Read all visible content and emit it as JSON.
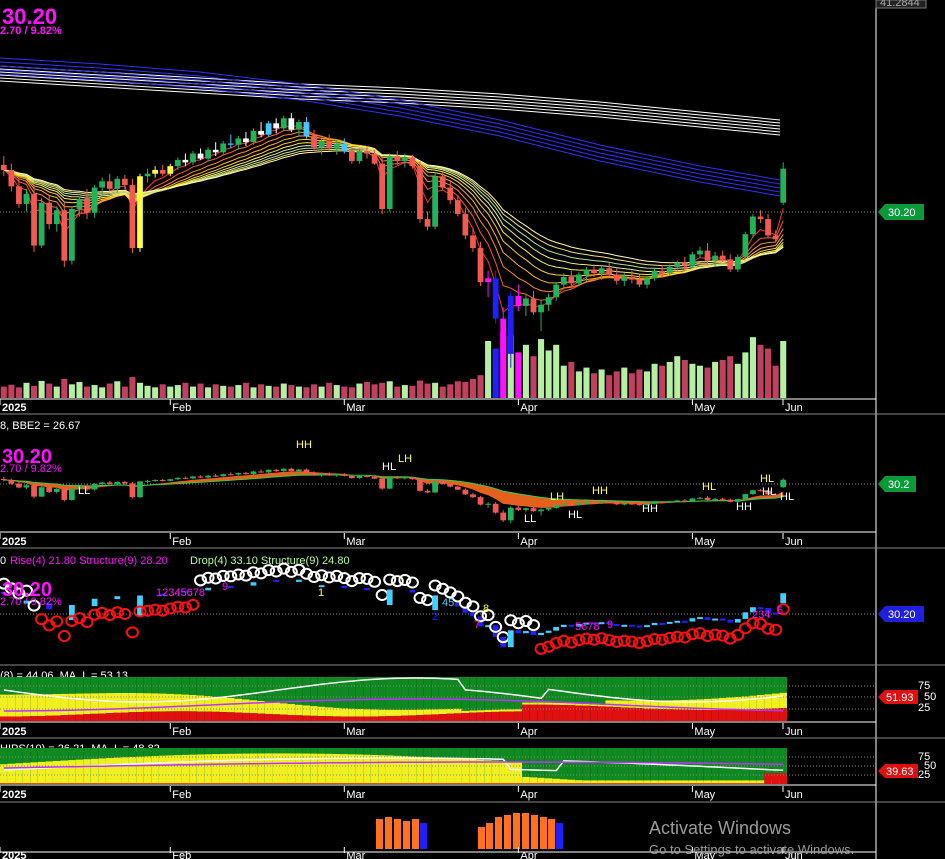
{
  "window": {
    "top_right_value": "41.2844",
    "watermark_title": "Activate Windows",
    "watermark_sub": "Go to Settings to activate Windows."
  },
  "colors": {
    "bg": "#000000",
    "bull": "#22b35a",
    "bear": "#f05a50",
    "vol_bull": "#b4f0a0",
    "vol_bear": "#c0405e",
    "sma_white": "#ffffff",
    "sma_blue": "#3030ff",
    "green_tag": "#0a9a3a",
    "blue_tag": "#1f1fe0",
    "red_tag": "#e01010",
    "magenta": "#ff10ff"
  },
  "price_panel": {
    "price_big": "30.20",
    "change_text": "2.70 / 9.82%",
    "last_price_tag": "30.20"
  },
  "panel2": {
    "header": "8, BBE2 = 26.67",
    "price_big": "30.20",
    "price_small": "2.70 / 9.82%",
    "last_tag": "30.2",
    "labels": [
      "HH",
      "LL",
      "HL",
      "LH",
      "LL",
      "LH",
      "HL",
      "HH",
      "HL",
      "HH",
      "HL",
      "HH",
      "HL",
      "HL"
    ]
  },
  "panel3": {
    "header_prefix": "0",
    "header_rise": "Rise(4) 21.80 Structure(9) 28.20",
    "header_drop": "Drop(4) 33.10 Structure(9) 24.80",
    "price_big": "30.20",
    "price_small": "2.70 / 9.82%",
    "last_tag": "30.20",
    "count_up": "12345678",
    "count_up_nine": "9",
    "count_2": "2",
    "count_45": "45",
    "count_7": "7",
    "count_8": "8",
    "count_5678": "5678",
    "count_nine2": "9",
    "count_234": "234",
    "count_5": "5",
    "count_1": "1"
  },
  "panel4": {
    "header": "(8) = 44.06, MA_L = 53.13",
    "levels": [
      "75",
      "50",
      "25"
    ],
    "last_tag": "51.93"
  },
  "panel5": {
    "header": "HIPS(10) = 26.21, MA_L = 48.82",
    "levels": [
      "75",
      "50",
      "25"
    ],
    "last_tag": "39.63"
  },
  "x_axis": {
    "labels": [
      "2025",
      "Feb",
      "Mar",
      "Apr",
      "May",
      "Jun"
    ]
  },
  "chart_data": [
    {
      "type": "candlestick",
      "categories_start": "2025",
      "x_ticks": [
        "2025",
        "Feb",
        "Mar",
        "Apr",
        "May",
        "Jun"
      ],
      "last_price": 30.2,
      "change": 2.7,
      "change_pct": 9.82,
      "candles": [
        [
          30.5,
          31.2,
          29.6,
          30.1
        ],
        [
          30.1,
          30.6,
          28.4,
          28.8
        ],
        [
          28.8,
          29.4,
          27.1,
          27.4
        ],
        [
          27.4,
          28.6,
          26.8,
          28.2
        ],
        [
          28.2,
          28.9,
          23.6,
          24.1
        ],
        [
          24.1,
          27.9,
          23.9,
          27.5
        ],
        [
          27.5,
          28.1,
          25.4,
          25.8
        ],
        [
          25.8,
          27.2,
          25.2,
          26.9
        ],
        [
          26.9,
          27.5,
          22.4,
          22.9
        ],
        [
          22.9,
          27.2,
          22.6,
          27.0
        ],
        [
          27.0,
          28.0,
          26.4,
          27.8
        ],
        [
          27.8,
          28.6,
          26.2,
          26.7
        ],
        [
          26.7,
          28.9,
          26.3,
          28.7
        ],
        [
          28.7,
          29.5,
          28.1,
          29.2
        ],
        [
          29.2,
          29.8,
          28.4,
          28.6
        ],
        [
          28.6,
          29.6,
          28.3,
          29.4
        ],
        [
          29.4,
          29.7,
          28.6,
          28.9
        ],
        [
          28.9,
          29.4,
          23.5,
          23.9
        ],
        [
          23.9,
          29.8,
          23.6,
          29.6
        ],
        [
          29.6,
          30.2,
          29.1,
          29.8
        ],
        [
          29.8,
          30.4,
          29.5,
          30.1
        ],
        [
          30.1,
          30.5,
          29.6,
          29.8
        ],
        [
          29.8,
          30.6,
          29.6,
          30.4
        ],
        [
          30.4,
          31.1,
          30.1,
          30.9
        ],
        [
          30.9,
          31.4,
          30.4,
          30.7
        ],
        [
          30.7,
          31.6,
          30.5,
          31.4
        ],
        [
          31.4,
          31.8,
          30.9,
          31.0
        ],
        [
          31.0,
          31.9,
          30.8,
          31.7
        ],
        [
          31.7,
          32.3,
          31.2,
          31.5
        ],
        [
          31.5,
          32.4,
          31.3,
          32.2
        ],
        [
          32.2,
          32.9,
          31.8,
          32.1
        ],
        [
          32.1,
          32.8,
          31.7,
          32.6
        ],
        [
          32.6,
          33.1,
          32.0,
          32.3
        ],
        [
          32.3,
          33.4,
          32.1,
          33.2
        ],
        [
          33.2,
          33.9,
          32.7,
          32.9
        ],
        [
          32.9,
          34.0,
          32.7,
          33.8
        ],
        [
          33.8,
          34.2,
          33.0,
          33.4
        ],
        [
          33.4,
          34.4,
          33.2,
          34.2
        ],
        [
          34.2,
          34.6,
          33.1,
          33.3
        ],
        [
          33.3,
          34.1,
          32.8,
          33.9
        ],
        [
          33.9,
          34.3,
          32.6,
          32.8
        ],
        [
          32.8,
          33.3,
          31.6,
          31.9
        ],
        [
          31.9,
          32.6,
          31.3,
          32.4
        ],
        [
          32.4,
          32.9,
          31.6,
          31.8
        ],
        [
          31.8,
          32.5,
          31.3,
          32.2
        ],
        [
          32.2,
          32.6,
          31.4,
          31.6
        ],
        [
          31.6,
          31.9,
          30.6,
          30.8
        ],
        [
          30.8,
          31.8,
          30.6,
          31.6
        ],
        [
          31.6,
          32.0,
          31.0,
          31.4
        ],
        [
          31.4,
          31.7,
          30.5,
          30.6
        ],
        [
          30.6,
          31.1,
          26.6,
          27.0
        ],
        [
          27.0,
          31.4,
          26.8,
          31.2
        ],
        [
          31.2,
          31.6,
          30.5,
          30.8
        ],
        [
          30.8,
          31.4,
          30.3,
          31.1
        ],
        [
          31.1,
          31.3,
          30.2,
          30.4
        ],
        [
          30.4,
          30.8,
          25.9,
          26.2
        ],
        [
          26.2,
          26.8,
          25.3,
          25.6
        ],
        [
          25.6,
          29.9,
          25.4,
          29.6
        ],
        [
          29.6,
          29.9,
          28.5,
          28.7
        ],
        [
          28.7,
          29.2,
          27.4,
          27.7
        ],
        [
          27.7,
          28.0,
          26.4,
          26.6
        ],
        [
          26.6,
          27.1,
          24.6,
          24.9
        ],
        [
          24.9,
          25.5,
          23.6,
          23.9
        ],
        [
          23.9,
          24.4,
          20.9,
          21.2
        ],
        [
          21.2,
          22.1,
          20.0,
          21.5
        ],
        [
          21.5,
          22.1,
          17.9,
          18.3
        ],
        [
          18.3,
          19.2,
          14.9,
          15.5
        ],
        [
          15.5,
          20.5,
          14.4,
          20.1
        ],
        [
          20.1,
          21.0,
          18.9,
          19.3
        ],
        [
          19.3,
          20.2,
          18.5,
          19.9
        ],
        [
          19.9,
          20.5,
          18.6,
          18.8
        ],
        [
          18.8,
          19.8,
          17.3,
          19.4
        ],
        [
          19.4,
          20.3,
          18.9,
          20.0
        ],
        [
          20.0,
          21.2,
          19.7,
          21.0
        ],
        [
          21.0,
          21.9,
          20.6,
          21.6
        ],
        [
          21.6,
          22.1,
          20.8,
          21.1
        ],
        [
          21.1,
          22.0,
          20.9,
          21.8
        ],
        [
          21.8,
          22.4,
          21.3,
          22.2
        ],
        [
          22.2,
          22.6,
          21.6,
          21.9
        ],
        [
          21.9,
          22.5,
          21.4,
          22.3
        ],
        [
          22.3,
          22.7,
          21.6,
          21.8
        ],
        [
          21.8,
          22.3,
          21.0,
          21.3
        ],
        [
          21.3,
          21.9,
          20.9,
          21.6
        ],
        [
          21.6,
          22.1,
          21.1,
          21.4
        ],
        [
          21.4,
          21.8,
          20.8,
          21.0
        ],
        [
          21.0,
          21.7,
          20.7,
          21.5
        ],
        [
          21.5,
          22.3,
          21.3,
          22.1
        ],
        [
          22.1,
          22.5,
          21.6,
          21.9
        ],
        [
          21.9,
          22.6,
          21.7,
          22.4
        ],
        [
          22.4,
          22.9,
          22.0,
          22.7
        ],
        [
          22.7,
          23.2,
          22.2,
          22.5
        ],
        [
          22.5,
          23.6,
          22.3,
          23.4
        ],
        [
          23.4,
          24.0,
          23.1,
          23.7
        ],
        [
          23.7,
          24.3,
          22.6,
          22.9
        ],
        [
          22.9,
          23.6,
          22.4,
          23.3
        ],
        [
          23.3,
          23.7,
          22.8,
          23.0
        ],
        [
          23.0,
          23.4,
          22.0,
          22.2
        ],
        [
          22.2,
          23.4,
          22.0,
          23.2
        ],
        [
          23.2,
          25.2,
          23.0,
          25.0
        ],
        [
          25.0,
          26.6,
          24.7,
          26.4
        ],
        [
          26.4,
          26.9,
          25.9,
          26.2
        ],
        [
          26.2,
          26.6,
          24.7,
          24.9
        ],
        [
          24.9,
          25.3,
          24.4,
          24.6
        ],
        [
          27.5,
          30.7,
          27.3,
          30.2
        ]
      ],
      "volume": [
        30,
        35,
        28,
        40,
        32,
        45,
        38,
        30,
        50,
        36,
        42,
        30,
        34,
        28,
        38,
        44,
        30,
        55,
        40,
        32,
        28,
        36,
        30,
        34,
        40,
        30,
        38,
        28,
        36,
        32,
        30,
        34,
        40,
        28,
        36,
        32,
        30,
        38,
        34,
        30,
        28,
        36,
        30,
        40,
        34,
        30,
        28,
        38,
        42,
        36,
        40,
        44,
        30,
        34,
        32,
        46,
        38,
        40,
        30,
        36,
        44,
        42,
        50,
        60,
        150,
        130,
        175,
        165,
        120,
        140,
        110,
        155,
        125,
        140,
        85,
        95,
        70,
        80,
        65,
        75,
        60,
        70,
        80,
        65,
        75,
        70,
        90,
        85,
        95,
        110,
        100,
        90,
        85,
        80,
        95,
        100,
        110,
        90,
        120,
        160,
        140,
        130,
        85,
        150
      ],
      "sma_white": [
        [
          0,
          66
        ],
        [
          100,
          72
        ],
        [
          200,
          78
        ],
        [
          300,
          84
        ],
        [
          400,
          88
        ],
        [
          500,
          94
        ],
        [
          600,
          102
        ],
        [
          700,
          112
        ],
        [
          780,
          120
        ]
      ],
      "sma_blue": [
        [
          0,
          58
        ],
        [
          100,
          64
        ],
        [
          200,
          72
        ],
        [
          300,
          84
        ],
        [
          400,
          100
        ],
        [
          500,
          120
        ],
        [
          600,
          145
        ],
        [
          700,
          166
        ],
        [
          780,
          180
        ]
      ]
    },
    {
      "type": "line",
      "title": "8, BBE2 = 26.67",
      "series": [
        {
          "name": "BBE2",
          "values": [
            26.67
          ]
        }
      ]
    },
    {
      "type": "line",
      "title": "(8) = 44.06, MA_L = 53.13",
      "ylim": [
        0,
        100
      ],
      "series": [
        {
          "name": "MA_L",
          "values": [
            53.13
          ]
        }
      ],
      "last_value": 51.93
    },
    {
      "type": "line",
      "title": "HIPS(10) = 26.21, MA_L = 48.82",
      "ylim": [
        0,
        100
      ],
      "series": [
        {
          "name": "HIPS(10)",
          "values": [
            26.21
          ]
        },
        {
          "name": "MA_L",
          "values": [
            48.82
          ]
        }
      ],
      "last_value": 39.63
    }
  ]
}
